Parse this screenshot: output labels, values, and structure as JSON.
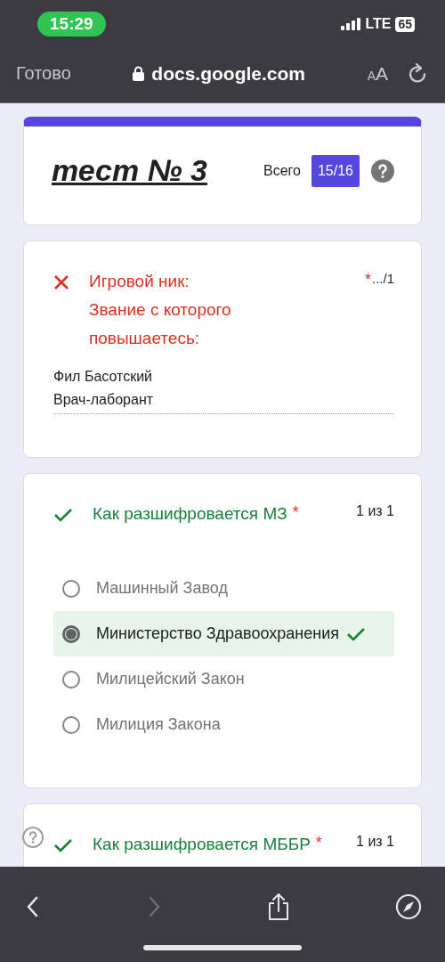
{
  "status_bar": {
    "time": "15:29",
    "network": "LTE",
    "battery": "65"
  },
  "browser": {
    "done": "Готово",
    "url": "docs.google.com",
    "text_size": "AA"
  },
  "header": {
    "title": "тест № 3",
    "total_label": "Всего",
    "score": "15/16"
  },
  "questions": [
    {
      "kind": "text",
      "correct": false,
      "title": "Игровой ник:\nЗвание с которого\nповышаетесь:",
      "required_mark": "*",
      "points": ".../1",
      "answer": "Фил Басотский\nВрач-лаборант"
    },
    {
      "kind": "choice",
      "correct": true,
      "title": "Как разшифровается МЗ",
      "required_mark": "*",
      "points": "1 из 1",
      "options": [
        {
          "label": "Машинный Завод",
          "selected": false
        },
        {
          "label": "Министерство Здравоохранения",
          "selected": true
        },
        {
          "label": "Милицейский Закон",
          "selected": false
        },
        {
          "label": "Милиция Закона",
          "selected": false
        }
      ]
    },
    {
      "kind": "choice",
      "correct": true,
      "title": "Как разшифровается МББР",
      "required_mark": "*",
      "points": "1 из 1"
    }
  ],
  "toolbar": [
    {
      "kind": "back",
      "disabled": false
    },
    {
      "kind": "forward",
      "disabled": true
    },
    {
      "kind": "share",
      "disabled": false
    },
    {
      "kind": "compass",
      "disabled": false
    }
  ]
}
